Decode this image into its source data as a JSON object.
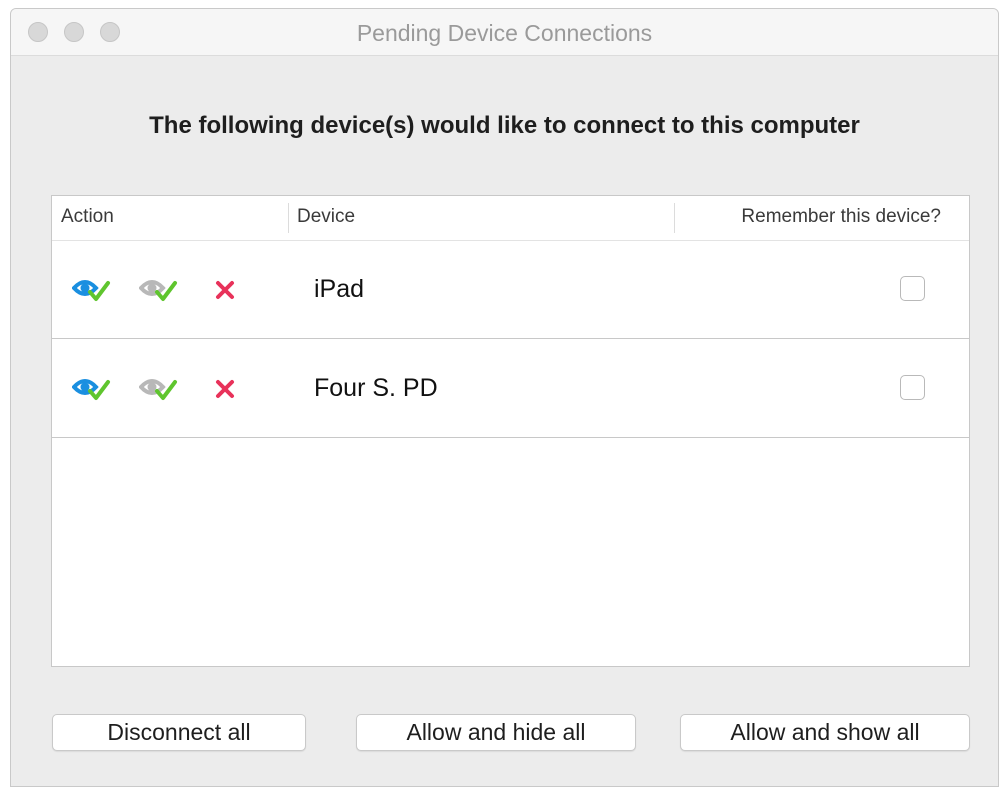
{
  "window": {
    "title": "Pending Device Connections"
  },
  "heading": "The following device(s) would like to connect to this computer",
  "table": {
    "columns": [
      "Action",
      "Device",
      "Remember this device?"
    ],
    "rows": [
      {
        "device": "iPad",
        "remember": false
      },
      {
        "device": "Four S. PD",
        "remember": false
      }
    ]
  },
  "icons": {
    "allow_show": "eye-check-icon",
    "allow_hide": "eye-check-gray-icon",
    "disconnect": "close-x-icon"
  },
  "colors": {
    "eye_blue": "#1a8fe0",
    "eye_gray": "#b8b8b8",
    "check_green": "#5fc52e",
    "x_red": "#e8325a"
  },
  "buttons": {
    "disconnect_all": "Disconnect all",
    "allow_hide_all": "Allow and hide all",
    "allow_show_all": "Allow and show all"
  }
}
